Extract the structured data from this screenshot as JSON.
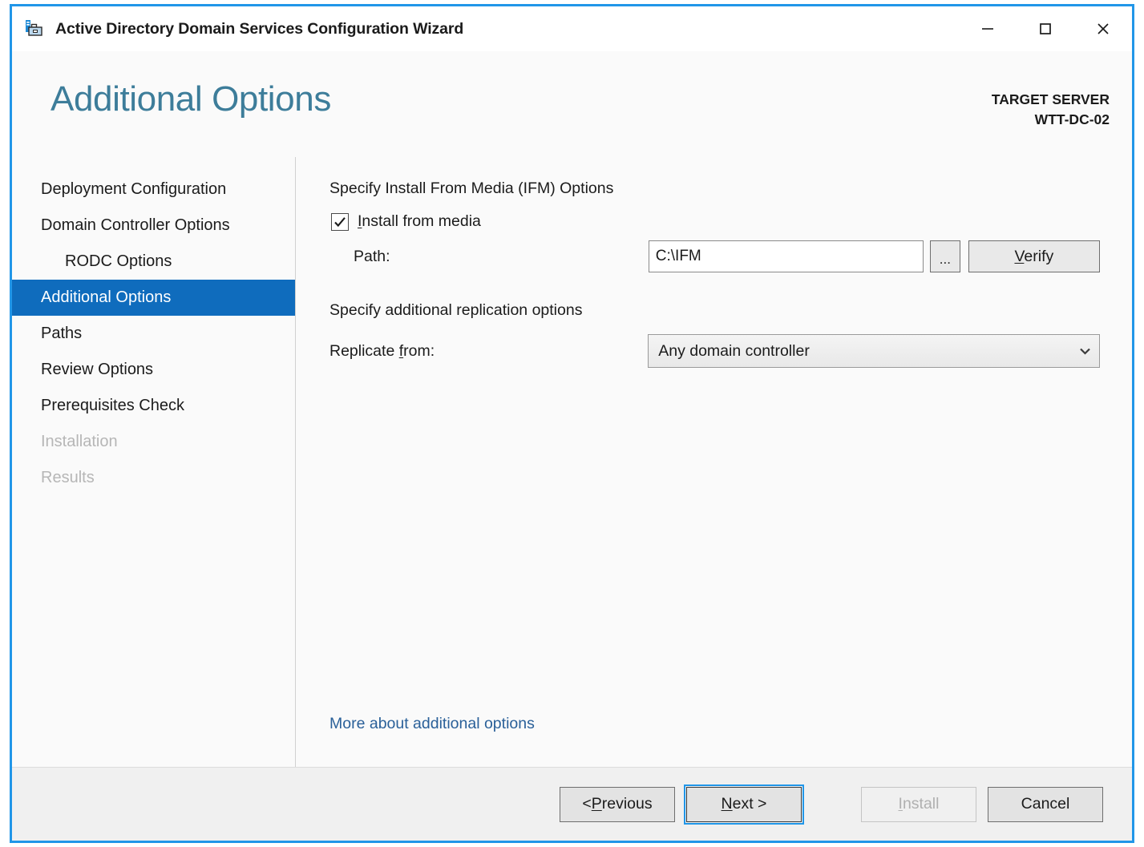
{
  "window": {
    "title": "Active Directory Domain Services Configuration Wizard",
    "icon": "ad-ds-server-icon",
    "controls": {
      "minimize": "–",
      "maximize": "☐",
      "close": "✕"
    },
    "border_color": "#2196e8"
  },
  "header": {
    "page_title": "Additional Options",
    "page_title_color": "#3d7d9a",
    "target_server_label": "TARGET SERVER",
    "target_server_name": "WTT-DC-02"
  },
  "sidebar": {
    "selected_color": "#0f6cbd",
    "items": [
      {
        "label": "Deployment Configuration",
        "state": "normal",
        "indent": false
      },
      {
        "label": "Domain Controller Options",
        "state": "normal",
        "indent": false
      },
      {
        "label": "RODC Options",
        "state": "normal",
        "indent": true
      },
      {
        "label": "Additional Options",
        "state": "selected",
        "indent": false
      },
      {
        "label": "Paths",
        "state": "normal",
        "indent": false
      },
      {
        "label": "Review Options",
        "state": "normal",
        "indent": false
      },
      {
        "label": "Prerequisites Check",
        "state": "normal",
        "indent": false
      },
      {
        "label": "Installation",
        "state": "disabled",
        "indent": false
      },
      {
        "label": "Results",
        "state": "disabled",
        "indent": false
      }
    ]
  },
  "content": {
    "ifm_section_heading": "Specify Install From Media (IFM) Options",
    "install_from_media": {
      "label_prefix": "",
      "label_accel": "I",
      "label_rest": "nstall from media",
      "checked": true,
      "check_glyph": "✓"
    },
    "path": {
      "label": "Path:",
      "value": "C:\\IFM",
      "placeholder": "",
      "browse_label": "...",
      "verify_accel": "V",
      "verify_rest": "erify"
    },
    "replication_section_heading": "Specify additional replication options",
    "replicate_from": {
      "label_prefix": "Replicate ",
      "label_accel": "f",
      "label_rest": "rom:",
      "selected": "Any domain controller",
      "arrow_glyph": "⌄"
    },
    "more_link": "More about additional options",
    "more_link_color": "#2a6099"
  },
  "footer": {
    "previous": {
      "prefix": "< ",
      "accel": "P",
      "rest": "revious",
      "state": "normal"
    },
    "next": {
      "prefix": "",
      "accel": "N",
      "rest": "ext >",
      "state": "focused"
    },
    "install": {
      "prefix": "",
      "accel": "I",
      "rest": "nstall",
      "state": "disabled"
    },
    "cancel": {
      "prefix": "Cancel",
      "accel": "",
      "rest": "",
      "state": "normal"
    }
  }
}
